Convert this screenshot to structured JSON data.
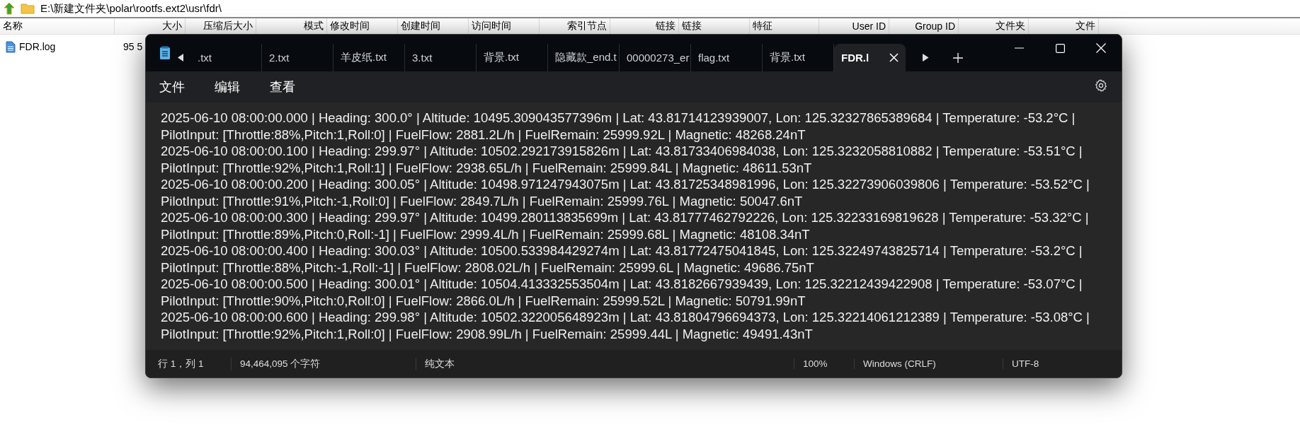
{
  "explorer": {
    "address": "E:\\新建文件夹\\polar\\rootfs.ext2\\usr\\fdr\\",
    "columns": [
      "名称",
      "大小",
      "压缩后大小",
      "模式",
      "修改时间",
      "创建时间",
      "访问时间",
      "索引节点",
      "链接",
      "链接",
      "特征",
      "User ID",
      "Group ID",
      "文件夹",
      "文件"
    ],
    "rows": [
      {
        "name": "FDR.log",
        "size": "95 5"
      }
    ]
  },
  "notepad": {
    "tabs": [
      {
        "label": ".txt",
        "selected": false
      },
      {
        "label": "2.txt",
        "selected": false
      },
      {
        "label": "羊皮纸.txt",
        "selected": false
      },
      {
        "label": "3.txt",
        "selected": false
      },
      {
        "label": "背景.txt",
        "selected": false
      },
      {
        "label": "隐藏款_end.t",
        "selected": false
      },
      {
        "label": "00000273_er",
        "selected": false
      },
      {
        "label": "flag.txt",
        "selected": false
      },
      {
        "label": "背景.txt",
        "selected": false
      },
      {
        "label": "FDR.l",
        "selected": true
      }
    ],
    "menu": [
      "文件",
      "编辑",
      "查看"
    ],
    "lines": [
      "2025-06-10 08:00:00.000 | Heading: 300.0° | Altitude: 10495.309043577396m | Lat: 43.81714123939007, Lon: 125.32327865389684 | Temperature: -53.2°C |",
      "PilotInput: [Throttle:88%,Pitch:1,Roll:0] | FuelFlow: 2881.2L/h | FuelRemain: 25999.92L | Magnetic: 48268.24nT",
      "2025-06-10 08:00:00.100 | Heading: 299.97° | Altitude: 10502.292173915826m | Lat: 43.81733406984038, Lon: 125.3232058810882 | Temperature: -53.51°C |",
      "PilotInput: [Throttle:92%,Pitch:1,Roll:1] | FuelFlow: 2938.65L/h | FuelRemain: 25999.84L | Magnetic: 48611.53nT",
      "2025-06-10 08:00:00.200 | Heading: 300.05° | Altitude: 10498.971247943075m | Lat: 43.81725348981996, Lon: 125.32273906039806 | Temperature: -53.52°C |",
      "PilotInput: [Throttle:91%,Pitch:-1,Roll:0] | FuelFlow: 2849.7L/h | FuelRemain: 25999.76L | Magnetic: 50047.6nT",
      "2025-06-10 08:00:00.300 | Heading: 299.97° | Altitude: 10499.280113835699m | Lat: 43.81777462792226, Lon: 125.32233169819628 | Temperature: -53.32°C |",
      "PilotInput: [Throttle:89%,Pitch:0,Roll:-1] | FuelFlow: 2999.4L/h | FuelRemain: 25999.68L | Magnetic: 48108.34nT",
      "2025-06-10 08:00:00.400 | Heading: 300.03° | Altitude: 10500.533984429274m | Lat: 43.81772475041845, Lon: 125.32249743825714 | Temperature: -53.2°C |",
      "PilotInput: [Throttle:88%,Pitch:-1,Roll:-1] | FuelFlow: 2808.02L/h | FuelRemain: 25999.6L | Magnetic: 49686.75nT",
      "2025-06-10 08:00:00.500 | Heading: 300.01° | Altitude: 10504.413332553504m | Lat: 43.8182667939439, Lon: 125.32212439422908 | Temperature: -53.07°C |",
      "PilotInput: [Throttle:90%,Pitch:0,Roll:0] | FuelFlow: 2866.0L/h | FuelRemain: 25999.52L | Magnetic: 50791.99nT",
      "2025-06-10 08:00:00.600 | Heading: 299.98° | Altitude: 10502.322005648923m | Lat: 43.81804796694373, Lon: 125.32214061212389 | Temperature: -53.08°C |",
      "PilotInput: [Throttle:92%,Pitch:1,Roll:0] | FuelFlow: 2908.99L/h | FuelRemain: 25999.44L | Magnetic: 49491.43nT"
    ],
    "status_bar": [
      "行 1，列 1",
      "94,464,095 个字符",
      "纯文本",
      "100%",
      "Windows (CRLF)",
      "UTF-8"
    ]
  }
}
